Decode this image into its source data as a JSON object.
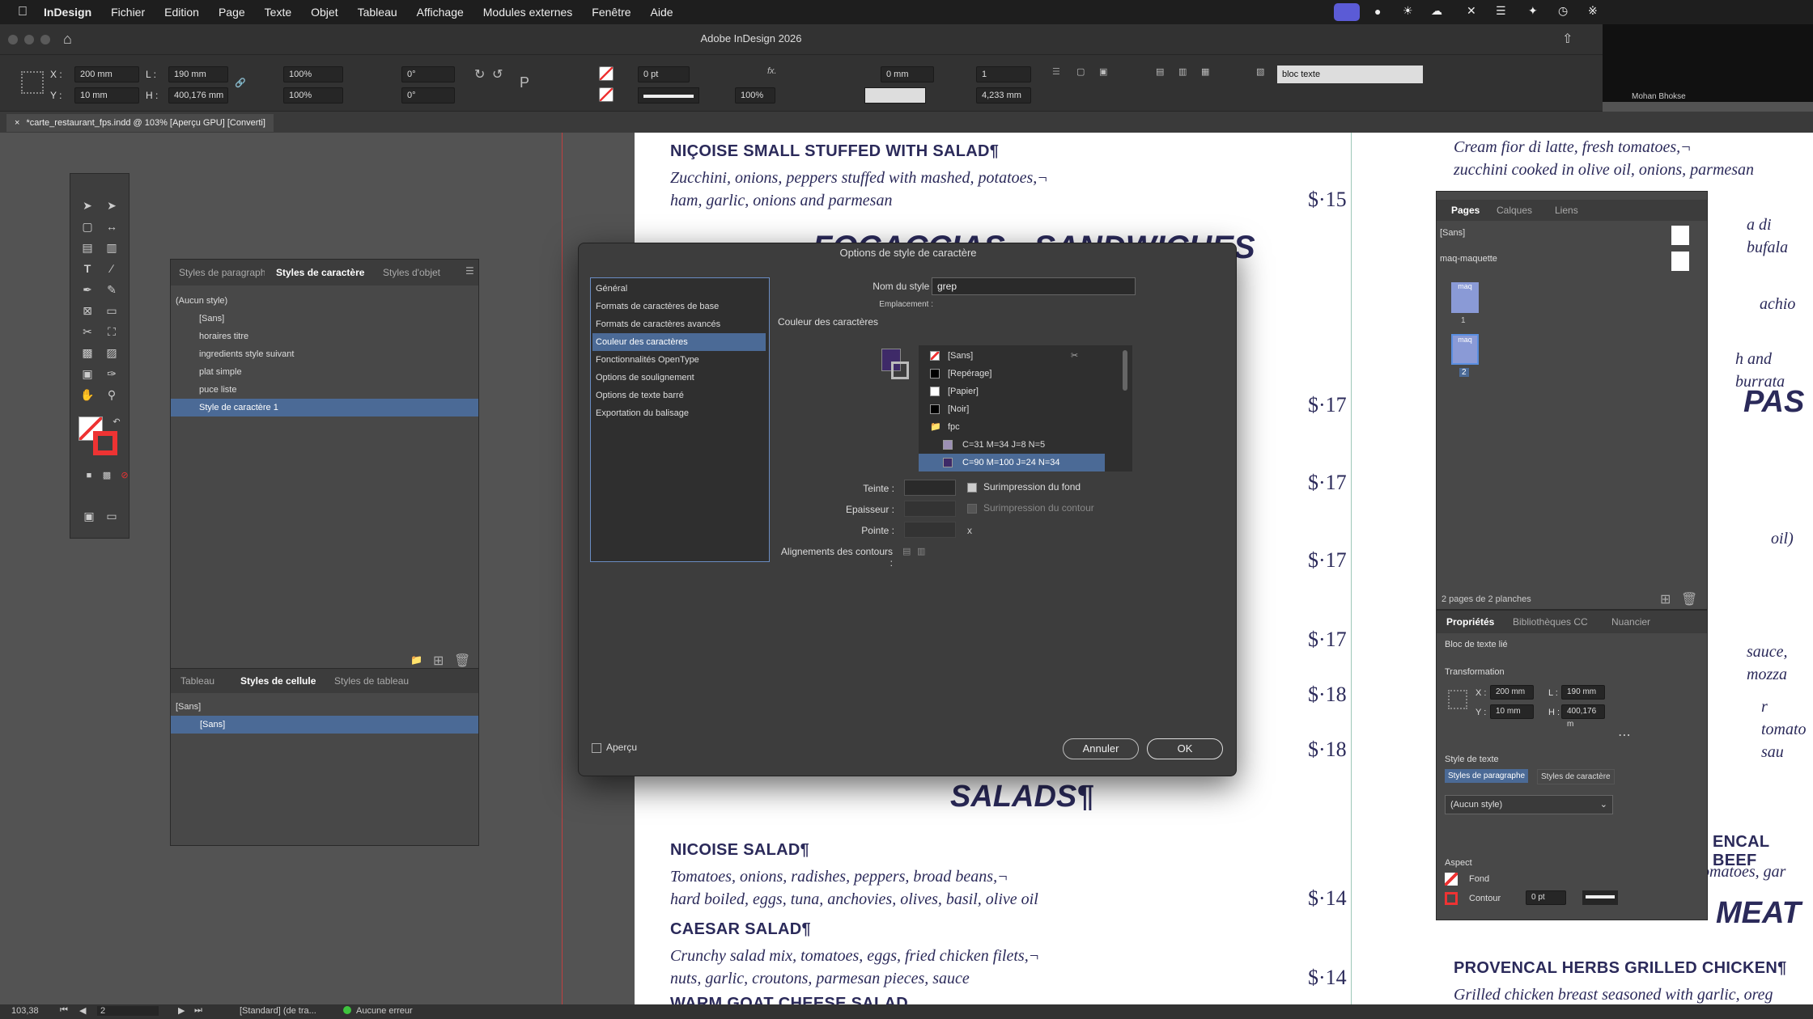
{
  "menubar": {
    "app": "InDesign",
    "items": [
      "Fichier",
      "Edition",
      "Page",
      "Texte",
      "Objet",
      "Tableau",
      "Affichage",
      "Modules externes",
      "Fenêtre",
      "Aide"
    ]
  },
  "window": {
    "title": "Adobe InDesign 2026",
    "extra": "Mohan Bhokse"
  },
  "control": {
    "x": "200 mm",
    "y": "10 mm",
    "w": "190 mm",
    "h": "400,176 mm",
    "scale_x": "100%",
    "scale_y": "100%",
    "angle": "0°",
    "shear": "0°",
    "stroke_pt": "0 pt",
    "opacity": "100%",
    "offset": "0 mm",
    "columns": "1",
    "gutter": "4,233 mm",
    "object_style": "bloc texte"
  },
  "doc_tab": "*carte_restaurant_fps.indd @ 103% [Aperçu GPU] [Converti]",
  "menu_page": {
    "items": [
      {
        "name": "NIÇOISE SMALL STUFFED WITH SALAD¶",
        "desc": [
          "Zucchini, onions, peppers stuffed with mashed, potatoes,¬",
          "ham, garlic, onions and parmesan"
        ],
        "price": "$·15"
      },
      {
        "name": "NICOISE SALAD¶",
        "desc": [
          "Tomatoes, onions, radishes, peppers, broad beans,¬",
          "hard boiled, eggs, tuna, anchovies, olives, basil, olive oil"
        ],
        "price": "$·14"
      },
      {
        "name": "CAESAR SALAD¶",
        "desc": [
          "Crunchy salad mix, tomatoes, eggs, fried chicken filets,¬",
          "nuts, garlic, croutons, parmesan pieces, sauce"
        ],
        "price": "$·14"
      }
    ],
    "header_focaccias": "FOCACCIAS · SANDWICHES",
    "header_salads": "SALADS¶",
    "prices_col": [
      "$·17",
      "$·17",
      "$·17",
      "$·17",
      "$·18",
      "$·18"
    ],
    "partial_next": "WARM GOAT CHEESE SALAD",
    "right_col": {
      "desc1": "Cream fior di latte, fresh tomatoes,¬",
      "desc2": "zucchini cooked in olive oil, onions, parmesan",
      "frag1": "a di bufala",
      "frag2": "achio",
      "frag3": "h and burrata",
      "header_pasta": "PAS",
      "frag4": "oil)",
      "frag5": "sauce, mozza",
      "frag6": "r tomato sau",
      "frag7": "ENCAL BEEF",
      "frag8": "omatoes, gar",
      "header_meat": "MEAT",
      "dish_chicken": "PROVENCAL HERBS GRILLED CHICKEN¶",
      "desc_chicken": "Grilled chicken breast seasoned with garlic, oreg"
    }
  },
  "styles_panel": {
    "tabs": [
      "Styles de paragraph",
      "Styles de caractère",
      "Styles d'objet"
    ],
    "none": "(Aucun style)",
    "items": [
      "[Sans]",
      "horaires titre",
      "ingredients style suivant",
      "plat simple",
      "puce liste",
      "Style de caractère 1"
    ],
    "selected": 5
  },
  "cell_panel": {
    "tabs": [
      "Tableau",
      "Styles de cellule",
      "Styles de tableau"
    ],
    "items": [
      "[Sans]",
      "[Sans]"
    ]
  },
  "pages_panel": {
    "tabs": [
      "Pages",
      "Calques",
      "Liens"
    ],
    "masters": [
      "[Sans]",
      "maq-maquette"
    ],
    "thumb_label": "maq",
    "page_numbers": [
      "1",
      "2"
    ],
    "footer": "2 pages de 2 planches"
  },
  "props_panel": {
    "tabs": [
      "Propriétés",
      "Bibliothèques CC",
      "Nuancier"
    ],
    "object_type": "Bloc de texte lié",
    "transformation": "Transformation",
    "x": "200 mm",
    "y": "10 mm",
    "w": "190 mm",
    "h": "400,176 m",
    "text_style": "Style de texte",
    "style_tabs": [
      "Styles de paragraphe",
      "Styles de caractère"
    ],
    "style_value": "(Aucun style)",
    "aspect": "Aspect",
    "fill": "Fond",
    "stroke": "Contour",
    "stroke_value": "0 pt"
  },
  "dialog": {
    "title": "Options de style de caractère",
    "categories": [
      "Général",
      "Formats de caractères de base",
      "Formats de caractères avancés",
      "Couleur des caractères",
      "Fonctionnalités OpenType",
      "Options de soulignement",
      "Options de texte barré",
      "Exportation du balisage"
    ],
    "selected_category": 3,
    "style_name_label": "Nom du style :",
    "style_name": "grep",
    "location_label": "Emplacement :",
    "section": "Couleur des caractères",
    "swatches": [
      "[Sans]",
      "[Repérage]",
      "[Papier]",
      "[Noir]",
      "fpc",
      "C=31 M=34 J=8 N=5",
      "C=90 M=100 J=24 N=34"
    ],
    "swatch_colors": [
      "#ffffff",
      "#000000",
      "#ffffff",
      "#000000",
      "",
      "#9c90b4",
      "#3e2a68"
    ],
    "selected_swatch": 6,
    "tint_label": "Teinte :",
    "overprint_fill": "Surimpression du fond",
    "weight_label": "Epaisseur :",
    "overprint_stroke": "Surimpression du contour",
    "miter_label": "Pointe :",
    "miter_x": "x",
    "align_label": "Alignements des contours :",
    "preview": "Aperçu",
    "cancel": "Annuler",
    "ok": "OK",
    "fill_color": "#3e2a68"
  },
  "status": {
    "zoom": "103,38",
    "page": "2",
    "profile": "[Standard] (de tra...",
    "errors": "Aucune erreur"
  },
  "colors": {
    "accent": "#4b6a96",
    "ink": "#2b2a5a"
  }
}
